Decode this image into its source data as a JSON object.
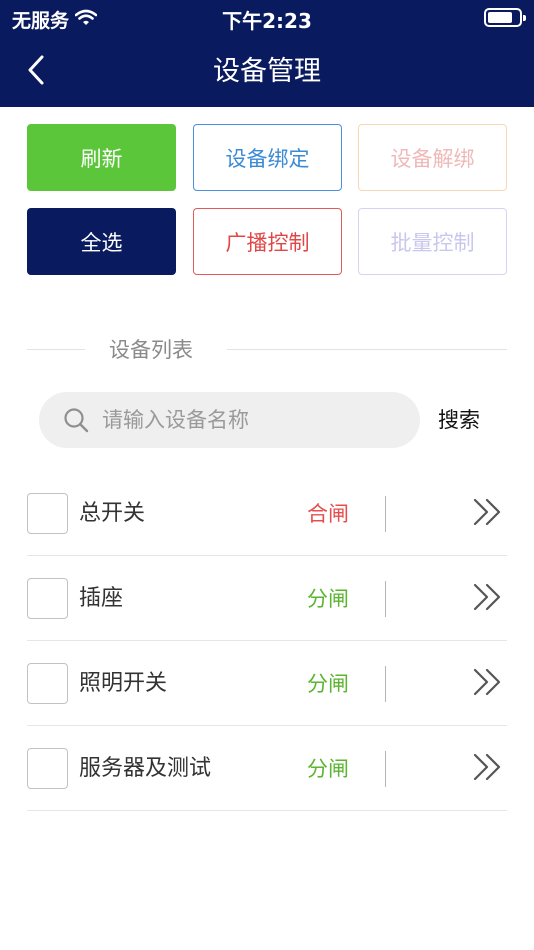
{
  "status_bar": {
    "carrier": "无服务",
    "time": "下午2:23"
  },
  "nav": {
    "title": "设备管理"
  },
  "actions": {
    "refresh": "刷新",
    "bind": "设备绑定",
    "unbind": "设备解绑",
    "select_all": "全选",
    "broadcast": "广播控制",
    "batch": "批量控制"
  },
  "section": {
    "title": "设备列表"
  },
  "search": {
    "placeholder": "请输入设备名称",
    "value": "",
    "button": "搜索"
  },
  "devices": [
    {
      "name": "总开关",
      "status": "合闸"
    },
    {
      "name": "插座",
      "status": "分闸"
    },
    {
      "name": "照明开关",
      "status": "分闸"
    },
    {
      "name": "服务器及测试",
      "status": "分闸"
    }
  ],
  "colors": {
    "header_bg": "#0a1a5e",
    "refresh_green": "#5cc63a",
    "bind_blue": "#3a8ad6",
    "broadcast_red": "#e04848",
    "status_closed_red": "#e64d4d",
    "status_open_green": "#5cb531"
  }
}
